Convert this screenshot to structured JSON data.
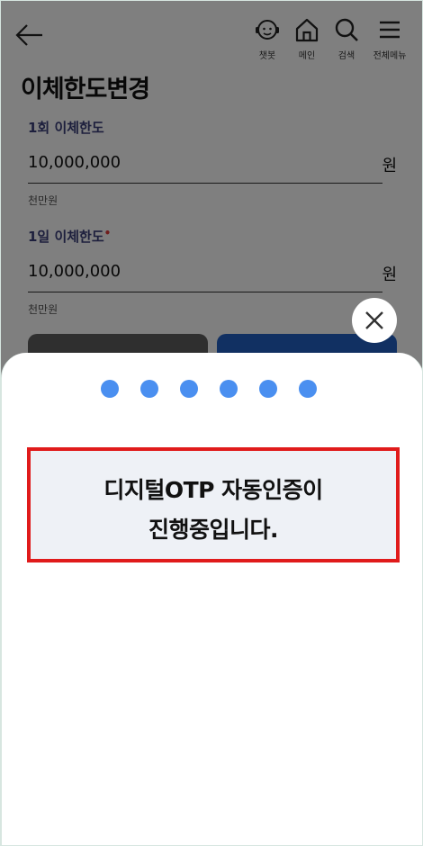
{
  "header": {
    "title": "이체한도변경",
    "nav": [
      {
        "label": "챗봇",
        "icon": "chatbot-icon"
      },
      {
        "label": "메인",
        "icon": "home-icon"
      },
      {
        "label": "검색",
        "icon": "search-icon"
      },
      {
        "label": "전체메뉴",
        "icon": "menu-icon"
      }
    ]
  },
  "fields": [
    {
      "label": "1회 이체한도",
      "value": "10,000,000",
      "unit": "원",
      "hint": "천만원"
    },
    {
      "label": "1일 이체한도",
      "required_mark": "•",
      "value": "10,000,000",
      "unit": "원",
      "hint": "천만원"
    }
  ],
  "overlay": {
    "message_line1": "디지털OTP 자동인증이",
    "message_line2": "진행중입니다.",
    "progress_dots": 6,
    "dot_color": "#4a8ff0",
    "highlight_color": "#e01b1b"
  }
}
